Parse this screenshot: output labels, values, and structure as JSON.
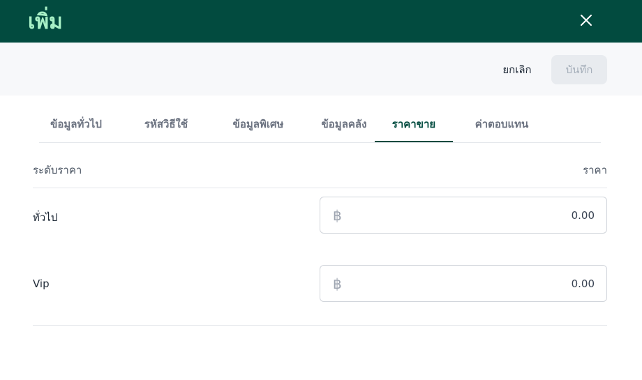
{
  "header": {
    "title": "เพิ่ม",
    "close_icon": "close-icon"
  },
  "actions": {
    "cancel_label": "ยกเลิก",
    "save_label": "บันทึก"
  },
  "tabs": [
    {
      "label": "ข้อมูลทั่วไป",
      "active": false
    },
    {
      "label": "รหัสวิธีใช้",
      "active": false
    },
    {
      "label": "ข้อมูลพิเศษ",
      "active": false
    },
    {
      "label": "ข้อมูลคลัง",
      "active": false
    },
    {
      "label": "ราคาขาย",
      "active": true
    },
    {
      "label": "ค่าตอบแทน",
      "active": false
    }
  ],
  "price_table": {
    "header_level": "ระดับราคา",
    "header_price": "ราคา",
    "currency_symbol": "฿",
    "rows": [
      {
        "label": "ทั่วไป",
        "value": "0.00"
      },
      {
        "label": "Vip",
        "value": "0.00"
      }
    ]
  },
  "colors": {
    "header_bg": "#024b3f",
    "title": "#a8f0c6",
    "active_tab": "#024b3f"
  }
}
